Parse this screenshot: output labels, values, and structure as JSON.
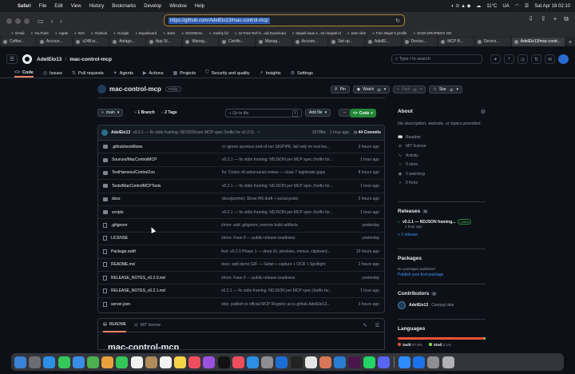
{
  "menubar": {
    "app": "Safari",
    "items": [
      "File",
      "Edit",
      "View",
      "History",
      "Bookmarks",
      "Develop",
      "Window",
      "Help"
    ],
    "weather": "11°C",
    "keyboard": "UA",
    "clock": "Sat Apr 18  02:10"
  },
  "browser": {
    "url": "https://github.com/AdelElo13/mac-control-mcp",
    "favorites": [
      "Gmail",
      "YouTube",
      "Apple",
      "ING",
      "Outlook",
      "Google",
      "Equaboard",
      "Jules",
      "SO20MAIL",
      "mashy lid",
      "10 Free Ref-X...uid Download",
      "lanjadi saus s...ton lanjadi nl",
      "Sam vibe",
      "Finn Wiger's profile",
      "SO20 DROPBOX NO"
    ],
    "tabs": [
      {
        "label": "Coffee..."
      },
      {
        "label": "Accoun..."
      },
      {
        "label": "s248.w..."
      },
      {
        "label": "Antago..."
      },
      {
        "label": "App St..."
      },
      {
        "label": "Manag..."
      },
      {
        "label": "Certific..."
      },
      {
        "label": "Manag..."
      },
      {
        "label": "Accoun..."
      },
      {
        "label": "Set up..."
      },
      {
        "label": "AdelEl..."
      },
      {
        "label": "Device..."
      },
      {
        "label": "MCP B..."
      },
      {
        "label": "Device..."
      },
      {
        "label": "AdelElo13/mac-contr..."
      }
    ]
  },
  "github": {
    "owner": "AdelElo13",
    "repo": "mac-control-mcp",
    "search_placeholder": "Type / to search",
    "search_key": "/",
    "nav": [
      {
        "label": "Code",
        "icon": "<>"
      },
      {
        "label": "Issues",
        "icon": "◎"
      },
      {
        "label": "Pull requests",
        "icon": "⇅"
      },
      {
        "label": "Agents",
        "icon": "✦"
      },
      {
        "label": "Actions",
        "icon": "▶"
      },
      {
        "label": "Projects",
        "icon": "▦"
      },
      {
        "label": "Security and quality",
        "icon": "⛉"
      },
      {
        "label": "Insights",
        "icon": "↗"
      },
      {
        "label": "Settings",
        "icon": "⚙"
      }
    ],
    "visibility": "Public",
    "actions": {
      "pin": "Pin",
      "watch": "Watch",
      "watch_count": "0",
      "fork": "Fork",
      "fork_count": "0",
      "star": "Star",
      "star_count": "0"
    },
    "branch": "main",
    "branches": "1 Branch",
    "tags": "2 Tags",
    "goto_placeholder": "Go to file",
    "goto_key": "t",
    "add_file": "Add file",
    "code_button": "Code",
    "latest_commit": {
      "author": "AdelElo13",
      "message": "v0.2.1 — fix stdio framing: NDJSON per MCP spec (hotfix for v0.2.0)",
      "sha_time": "1678fbc · 1 hour ago",
      "commits": "44 Commits"
    },
    "files": [
      {
        "type": "dir",
        "name": ".github/workflows",
        "commit": "ci: ignore spurious end-of-run SIGPIPE, fail only on real tes...",
        "time": "3 hours ago"
      },
      {
        "type": "dir",
        "name": "Sources/MacControlMCP",
        "commit": "v0.2.1 — fix stdio framing: NDJSON per MCP spec (hotfix for...",
        "time": "1 hour ago"
      },
      {
        "type": "dir",
        "name": "TestHarness/ControlZoo",
        "commit": "fix: Codex v8 adversarial review — close 7 legitimate gaps",
        "time": "8 hours ago"
      },
      {
        "type": "dir",
        "name": "Tests/MacControlMCPTests",
        "commit": "v0.2.1 — fix stdio framing: NDJSON per MCP spec (hotfix for...",
        "time": "1 hour ago"
      },
      {
        "type": "dir",
        "name": "docs",
        "commit": "docs(promo): Show HN draft + social posts",
        "time": "2 hours ago"
      },
      {
        "type": "dir",
        "name": "scripts",
        "commit": "v0.2.1 — fix stdio framing: NDJSON per MCP spec (hotfix for...",
        "time": "1 hour ago"
      },
      {
        "type": "file",
        "name": ".gitignore",
        "commit": "chore: add .gitignore, remove build artifacts",
        "time": "yesterday"
      },
      {
        "type": "file",
        "name": "LICENSE",
        "commit": "chore: Fase 0 — public-release readiness",
        "time": "yesterday"
      },
      {
        "type": "file",
        "name": "Package.swift",
        "commit": "feat: v0.2.0 Phase 1 — deep UI, windows, menus, clipboard...",
        "time": "10 hours ago"
      },
      {
        "type": "file",
        "name": "README.md",
        "commit": "docs: add demo GIF — Safari + capture + OCR + Spotlight",
        "time": "2 hours ago"
      },
      {
        "type": "file",
        "name": "RELEASE_NOTES_v0.2.0.md",
        "commit": "chore: Fase 0 — public-release readiness",
        "time": "yesterday"
      },
      {
        "type": "file",
        "name": "RELEASE_NOTES_v0.2.1.md",
        "commit": "v0.2.1 — fix stdio framing: NDJSON per MCP spec (hotfix for...",
        "time": "1 hour ago"
      },
      {
        "type": "file",
        "name": "server.json",
        "commit": "ship: publish to official MCP Registry as io.github.AdelElo13...",
        "time": "3 hours ago"
      }
    ],
    "readme_tabs": [
      "README",
      "MIT license"
    ],
    "readme_heading": "mac-control-mcp",
    "about": {
      "title": "About",
      "description": "No description, website, or topics provided.",
      "stats": [
        {
          "icon": "📖",
          "label": "Readme"
        },
        {
          "icon": "⚖",
          "label": "MIT license"
        },
        {
          "icon": "∿",
          "label": "Activity"
        },
        {
          "icon": "☆",
          "label": "0 stars"
        },
        {
          "icon": "◉",
          "label": "0 watching"
        },
        {
          "icon": "⑂",
          "label": "0 forks"
        }
      ]
    },
    "releases": {
      "title": "Releases",
      "count": "2",
      "latest_name": "v0.2.1 — NDJSON framing...",
      "latest_badge": "Latest",
      "latest_time": "1 hour ago",
      "more": "+ 1 release"
    },
    "packages": {
      "title": "Packages",
      "empty": "No packages published",
      "link": "Publish your first package"
    },
    "contributors": {
      "title": "Contributors",
      "count": "1",
      "user": "AdelElo13",
      "name": "CanopyLabs"
    },
    "languages": {
      "title": "Languages",
      "items": [
        {
          "name": "Swift",
          "pct": "97.9%",
          "value": 97.9,
          "color": "#F05138"
        },
        {
          "name": "Shell",
          "pct": "2.1%",
          "value": 2.1,
          "color": "#89e051"
        }
      ]
    }
  },
  "dock": {
    "apps": [
      {
        "icon": "finder-icon",
        "color": "#3b82d6"
      },
      {
        "icon": "launchpad-icon",
        "color": "#6c6c74"
      },
      {
        "icon": "safari-icon",
        "color": "#2d8ee6"
      },
      {
        "icon": "messages-icon",
        "color": "#34c759"
      },
      {
        "icon": "mail-icon",
        "color": "#3a8ee6"
      },
      {
        "icon": "maps-icon",
        "color": "#4caf50"
      },
      {
        "icon": "photos-icon",
        "color": "#e9a23b"
      },
      {
        "icon": "facetime-icon",
        "color": "#34c759"
      },
      {
        "icon": "calendar-icon",
        "color": "#f2f2f2"
      },
      {
        "icon": "contacts-icon",
        "color": "#b08c5a"
      },
      {
        "icon": "reminders-icon",
        "color": "#f2f2f2"
      },
      {
        "icon": "notes-icon",
        "color": "#f5d34a"
      },
      {
        "icon": "music-icon",
        "color": "#f04e5e"
      },
      {
        "icon": "podcasts-icon",
        "color": "#9b51e0"
      },
      {
        "icon": "tv-icon",
        "color": "#111111"
      },
      {
        "icon": "news-icon",
        "color": "#f04e5e"
      },
      {
        "icon": "appstore-icon",
        "color": "#2d8ee6"
      },
      {
        "icon": "settings-icon",
        "color": "#8e8e93"
      },
      {
        "icon": "xcode-icon",
        "color": "#1c6ed5"
      },
      {
        "icon": "terminal-icon",
        "color": "#222222"
      },
      {
        "icon": "chatgpt-icon",
        "color": "#e5e5e5"
      },
      {
        "icon": "claude-icon",
        "color": "#d97757"
      },
      {
        "icon": "vscode-icon",
        "color": "#2a7cd1"
      },
      {
        "icon": "slack-icon",
        "color": "#4a154b"
      },
      {
        "icon": "whatsapp-icon",
        "color": "#25d366"
      },
      {
        "icon": "discord-icon",
        "color": "#5865f2"
      },
      {
        "icon": "zoom-icon",
        "color": "#2d8cff"
      },
      {
        "icon": "1password-icon",
        "color": "#1a73e8"
      },
      {
        "icon": "preview-icon",
        "color": "#8e8e93"
      },
      {
        "icon": "trash-icon",
        "color": "#b0b0b5"
      }
    ]
  }
}
